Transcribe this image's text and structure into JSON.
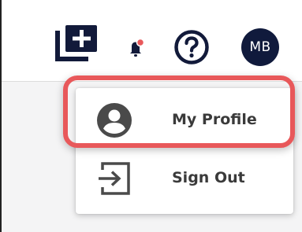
{
  "header": {
    "add_icon": "add-box-icon",
    "notifications_icon": "bell-icon",
    "notification_badge_color": "#e8585a",
    "help_icon": "help-circle-icon",
    "avatar": {
      "initials": "MB",
      "background": "#101a3c"
    }
  },
  "user_menu": {
    "items": [
      {
        "label": "My Profile",
        "icon": "account-circle-icon",
        "highlighted": true
      },
      {
        "label": "Sign Out",
        "icon": "sign-out-icon",
        "highlighted": false
      }
    ]
  },
  "annotation": {
    "highlight_color": "#e8585a"
  }
}
